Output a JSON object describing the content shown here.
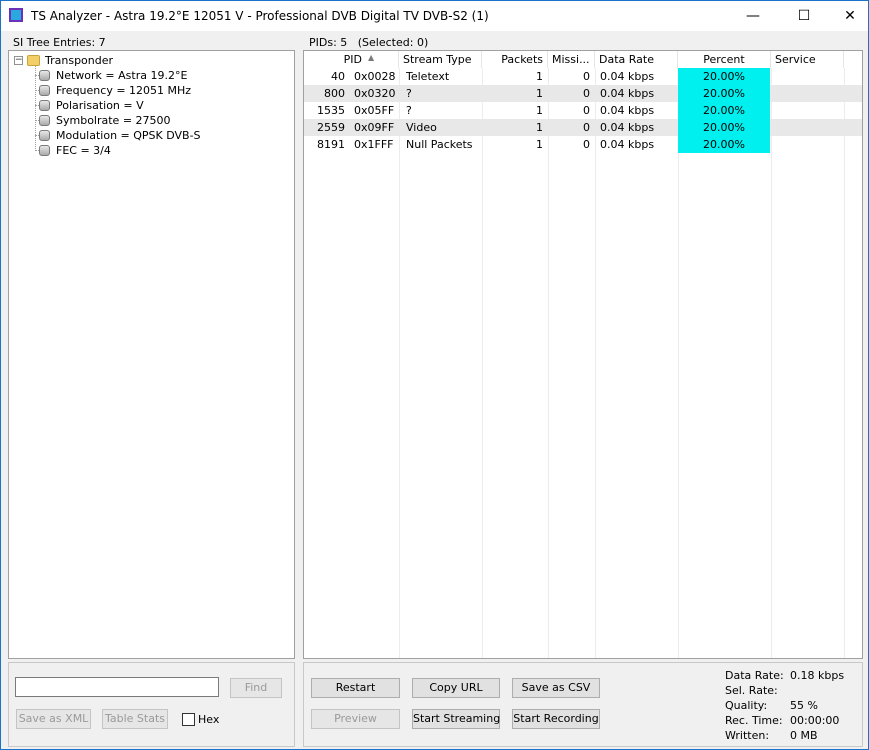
{
  "window": {
    "title": "TS Analyzer - Astra 19.2°E 12051 V - Professional DVB Digital TV DVB-S2 (1)",
    "minimize_glyph": "—",
    "maximize_glyph": "☐",
    "close_glyph": "✕",
    "accent_color": "#1a73c8"
  },
  "si_tree": {
    "label": "SI Tree Entries: 7",
    "root": {
      "label": "Transponder",
      "expander": "−"
    },
    "children": [
      "Network = Astra 19.2°E",
      "Frequency = 12051 MHz",
      "Polarisation = V",
      "Symbolrate = 27500",
      "Modulation = QPSK DVB-S",
      "FEC = 3/4"
    ]
  },
  "pids": {
    "label": "PIDs: 5   (Selected: 0)",
    "sort_indicator": "▲",
    "columns": [
      "PID",
      "Stream Type",
      "Packets",
      "Missi...",
      "Data Rate",
      "Percent",
      "Service"
    ],
    "rows": [
      {
        "pid": "40",
        "hex": "0x0028",
        "stream_type": "Teletext",
        "packets": "1",
        "missing": "0",
        "data_rate": "0.04 kbps",
        "percent": "20.00%",
        "service": ""
      },
      {
        "pid": "800",
        "hex": "0x0320",
        "stream_type": "?",
        "packets": "1",
        "missing": "0",
        "data_rate": "0.04 kbps",
        "percent": "20.00%",
        "service": ""
      },
      {
        "pid": "1535",
        "hex": "0x05FF",
        "stream_type": "?",
        "packets": "1",
        "missing": "0",
        "data_rate": "0.04 kbps",
        "percent": "20.00%",
        "service": ""
      },
      {
        "pid": "2559",
        "hex": "0x09FF",
        "stream_type": "Video",
        "packets": "1",
        "missing": "0",
        "data_rate": "0.04 kbps",
        "percent": "20.00%",
        "service": ""
      },
      {
        "pid": "8191",
        "hex": "0x1FFF",
        "stream_type": "Null Packets",
        "packets": "1",
        "missing": "0",
        "data_rate": "0.04 kbps",
        "percent": "20.00%",
        "service": ""
      }
    ],
    "percent_color": "#00f0f0"
  },
  "left_controls": {
    "search_value": "",
    "find_label": "Find",
    "save_xml_label": "Save as XML",
    "table_stats_label": "Table Stats",
    "hex_label": "Hex",
    "hex_checked": false
  },
  "right_controls": {
    "restart_label": "Restart",
    "copy_url_label": "Copy URL",
    "save_csv_label": "Save as CSV",
    "preview_label": "Preview",
    "start_streaming_label": "Start Streaming",
    "start_recording_label": "Start Recording"
  },
  "stats": [
    {
      "label": "Data Rate:",
      "value": "0.18 kbps"
    },
    {
      "label": "Sel. Rate:",
      "value": ""
    },
    {
      "label": "Quality:",
      "value": "55 %"
    },
    {
      "label": "Rec. Time:",
      "value": "00:00:00"
    },
    {
      "label": "Written:",
      "value": "0 MB"
    }
  ]
}
